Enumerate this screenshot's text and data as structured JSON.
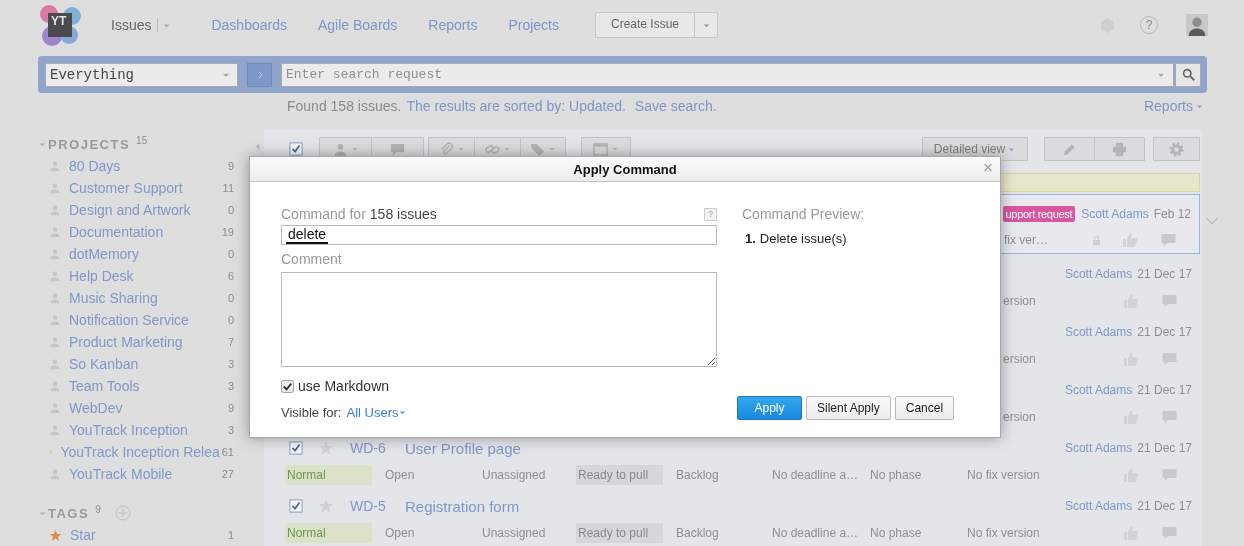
{
  "logo": "YT",
  "nav": [
    {
      "label": "Issues",
      "selected": true,
      "menu": true
    },
    {
      "label": "Dashboards",
      "selected": false,
      "menu": false
    },
    {
      "label": "Agile Boards",
      "selected": false,
      "menu": false
    },
    {
      "label": "Reports",
      "selected": false,
      "menu": false
    },
    {
      "label": "Projects",
      "selected": false,
      "menu": false
    }
  ],
  "create_button": "Create Issue",
  "help": "?",
  "search": {
    "context": "Everything",
    "placeholder": "Enter search request"
  },
  "results": {
    "found": "Found 158 issues.",
    "sorted": "The results are sorted by: Updated.",
    "save": "Save search.",
    "reports": "Reports"
  },
  "sidebar": {
    "projects": {
      "title": "PROJECTS",
      "count": "15",
      "items": [
        {
          "name": "80 Days",
          "count": "9"
        },
        {
          "name": "Customer Support",
          "count": "11"
        },
        {
          "name": "Design and Artwork",
          "count": "0"
        },
        {
          "name": "Documentation",
          "count": "19"
        },
        {
          "name": "dotMemory",
          "count": "0"
        },
        {
          "name": "Help Desk",
          "count": "6"
        },
        {
          "name": "Music Sharing",
          "count": "0"
        },
        {
          "name": "Notification Service",
          "count": "0"
        },
        {
          "name": "Product Marketing",
          "count": "7"
        },
        {
          "name": "So Kanban",
          "count": "3"
        },
        {
          "name": "Team Tools",
          "count": "3"
        },
        {
          "name": "WebDev",
          "count": "9"
        },
        {
          "name": "YouTrack Inception",
          "count": "3"
        },
        {
          "name": "YouTrack Inception Relea",
          "count": "61"
        },
        {
          "name": "YouTrack Mobile",
          "count": "27"
        }
      ]
    },
    "tags": {
      "title": "TAGS",
      "count": "9",
      "items": [
        {
          "name": "Star",
          "count": "1"
        }
      ]
    }
  },
  "toolbar": {
    "select_all": {
      "checked": true
    },
    "view": "Detailed view"
  },
  "issues": [
    {
      "selected": true,
      "tag": {
        "label": "upport request",
        "color": "#d6569f"
      },
      "author": "Scott Adams",
      "date": "Feb 12",
      "fix_version": "fix ver…",
      "locked": true
    },
    {
      "selected": false,
      "author": "Scott Adams",
      "date": "21 Dec 17",
      "fix_version": "ersion",
      "locked": false
    },
    {
      "selected": false,
      "author": "Scott Adams",
      "date": "21 Dec 17",
      "fix_version": "ersion",
      "locked": false
    },
    {
      "selected": false,
      "author": "Scott Adams",
      "date": "21 Dec 17",
      "fix_version": "ersion",
      "locked": false
    },
    {
      "selected": false,
      "checked": true,
      "starred": false,
      "id": "WD-6",
      "summary": "User Profile page",
      "author": "Scott Adams",
      "date": "21 Dec 17",
      "priority": "Normal",
      "state": "Open",
      "assignee": "Unassigned",
      "stage": "Ready to pull",
      "sprint": "Backlog",
      "deadline": "No deadline a…",
      "phase": "No phase",
      "fix_version": "No fix version",
      "locked": false
    },
    {
      "selected": false,
      "checked": true,
      "starred": false,
      "id": "WD-5",
      "summary": "Registration form",
      "author": "Scott Adams",
      "date": "21 Dec 17",
      "priority": "Normal",
      "state": "Open",
      "assignee": "Unassigned",
      "stage": "Ready to pull",
      "sprint": "Backlog",
      "deadline": "No deadline a…",
      "phase": "No phase",
      "fix_version": "No fix version",
      "locked": false
    }
  ],
  "dialog": {
    "title": "Apply Command",
    "close": "×",
    "command_label": "Command for",
    "command_count": "158 issues",
    "help": "?",
    "command": "delete",
    "comment_label": "Comment",
    "markdown": {
      "label": "use Markdown",
      "checked": true
    },
    "visible_label": "Visible for:",
    "visible_value": "All Users",
    "preview_title": "Command Preview:",
    "preview": [
      {
        "number": "1.",
        "text": "Delete issue(s)"
      }
    ],
    "buttons": [
      {
        "label": "Apply",
        "kind": "primary"
      },
      {
        "label": "Silent Apply",
        "kind": "default"
      },
      {
        "label": "Cancel",
        "kind": "default"
      }
    ]
  }
}
